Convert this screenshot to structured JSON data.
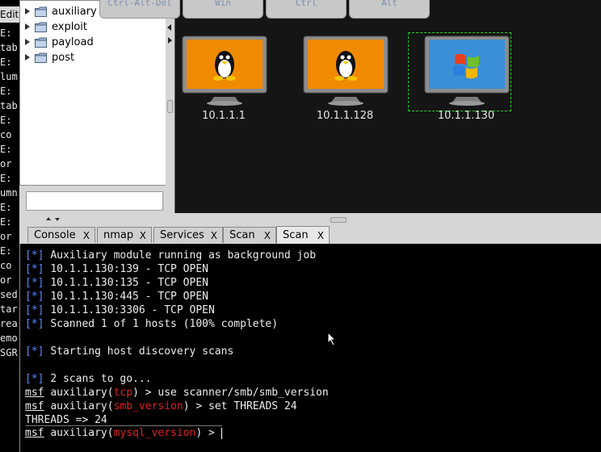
{
  "left_terminal": {
    "menu_label": "Edit",
    "lines": [
      "E:",
      "tab",
      "E:",
      "lum",
      "E:",
      "tab",
      "E:",
      "co",
      "E:",
      "or",
      "E:",
      "umn",
      "E:",
      "E:",
      "or",
      "E:",
      "co",
      "or",
      "sed",
      "tar",
      "rea",
      "emo",
      "SGR"
    ]
  },
  "module_tree": {
    "items": [
      {
        "label": "auxiliary"
      },
      {
        "label": "exploit"
      },
      {
        "label": "payload"
      },
      {
        "label": "post"
      }
    ],
    "search_value": ""
  },
  "target_toolbar": {
    "buttons": [
      "Ctrl-Alt-Del",
      "Win",
      "Ctrl",
      "Alt"
    ]
  },
  "hosts": [
    {
      "ip": "10.1.1.1",
      "os": "linux",
      "selected": false
    },
    {
      "ip": "10.1.1.128",
      "os": "linux",
      "selected": false
    },
    {
      "ip": "10.1.1.130",
      "os": "windows",
      "selected": true
    }
  ],
  "tabs": [
    {
      "label": "Console",
      "close": "X"
    },
    {
      "label": "nmap",
      "close": "X"
    },
    {
      "label": "Services",
      "close": "X"
    },
    {
      "label": "Scan",
      "close": "X"
    },
    {
      "label": "Scan",
      "close": "X",
      "active": true
    }
  ],
  "console": {
    "status_marker": "[*]",
    "status_lines": [
      "Auxiliary module running as background job",
      "10.1.1.130:139 - TCP OPEN",
      "10.1.1.130:135 - TCP OPEN",
      "10.1.1.130:445 - TCP OPEN",
      "10.1.1.130:3306 - TCP OPEN",
      "Scanned 1 of 1 hosts (100% complete)",
      "Starting host discovery scans",
      "2 scans to go..."
    ],
    "prompt_name": "msf",
    "prompts": [
      {
        "context": "auxiliary",
        "module": "tcp",
        "command": "use scanner/smb/smb_version"
      },
      {
        "context": "auxiliary",
        "module": "smb_version",
        "command": "set THREADS 24"
      },
      {
        "context": "auxiliary",
        "module": "mysql_version",
        "command": ""
      }
    ],
    "output_line": "THREADS => 24"
  },
  "colors": {
    "status_marker": "#5a8bff",
    "module_name": "#e02020",
    "selection": "#1fcf1f",
    "monitor_linux": "#f08a00",
    "monitor_windows": "#3a8fd8"
  }
}
